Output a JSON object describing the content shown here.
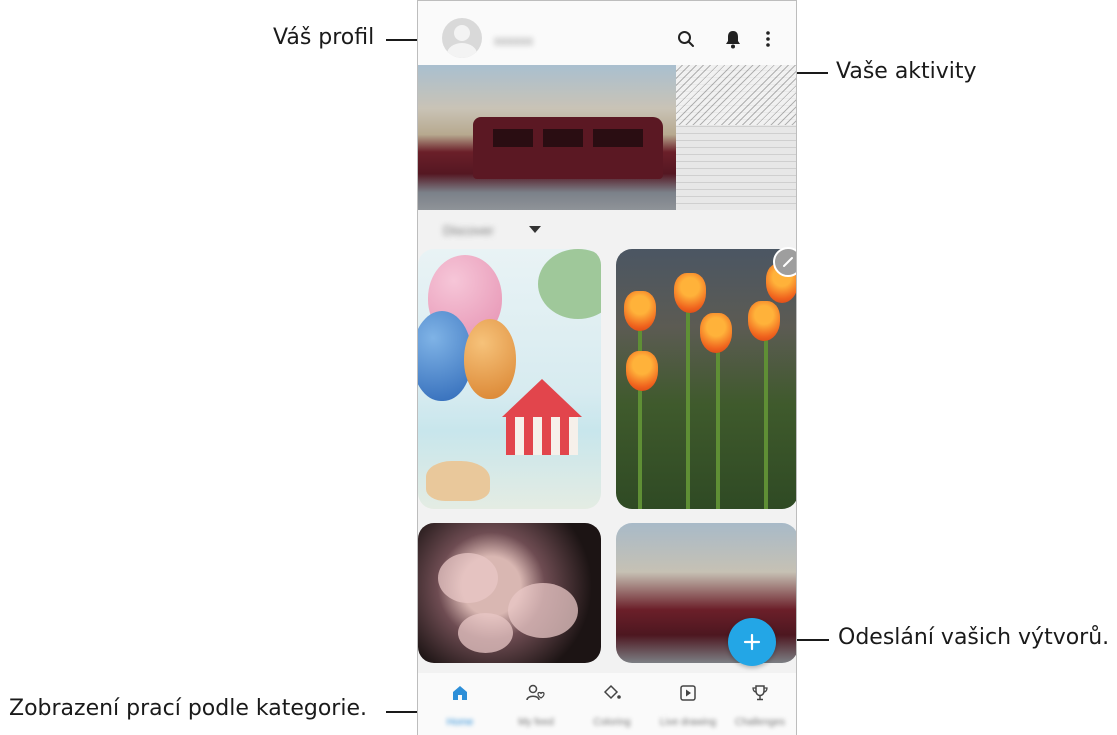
{
  "callouts": {
    "profile": "Váš profil",
    "activities": "Vaše aktivity",
    "submit": "Odeslání vašich výtvorů.",
    "categories": "Zobrazení prací podle kategorie."
  },
  "app": {
    "username": "xxxxxx",
    "category_label": "Discover",
    "nav": [
      {
        "label": "Home",
        "icon": "home-icon"
      },
      {
        "label": "My feed",
        "icon": "profile-heart-icon"
      },
      {
        "label": "Coloring",
        "icon": "paint-bucket-icon"
      },
      {
        "label": "Live drawing",
        "icon": "play-icon"
      },
      {
        "label": "Challenges",
        "icon": "trophy-icon"
      }
    ]
  },
  "colors": {
    "accent": "#23a6e6",
    "active_nav": "#2d8fd8"
  }
}
